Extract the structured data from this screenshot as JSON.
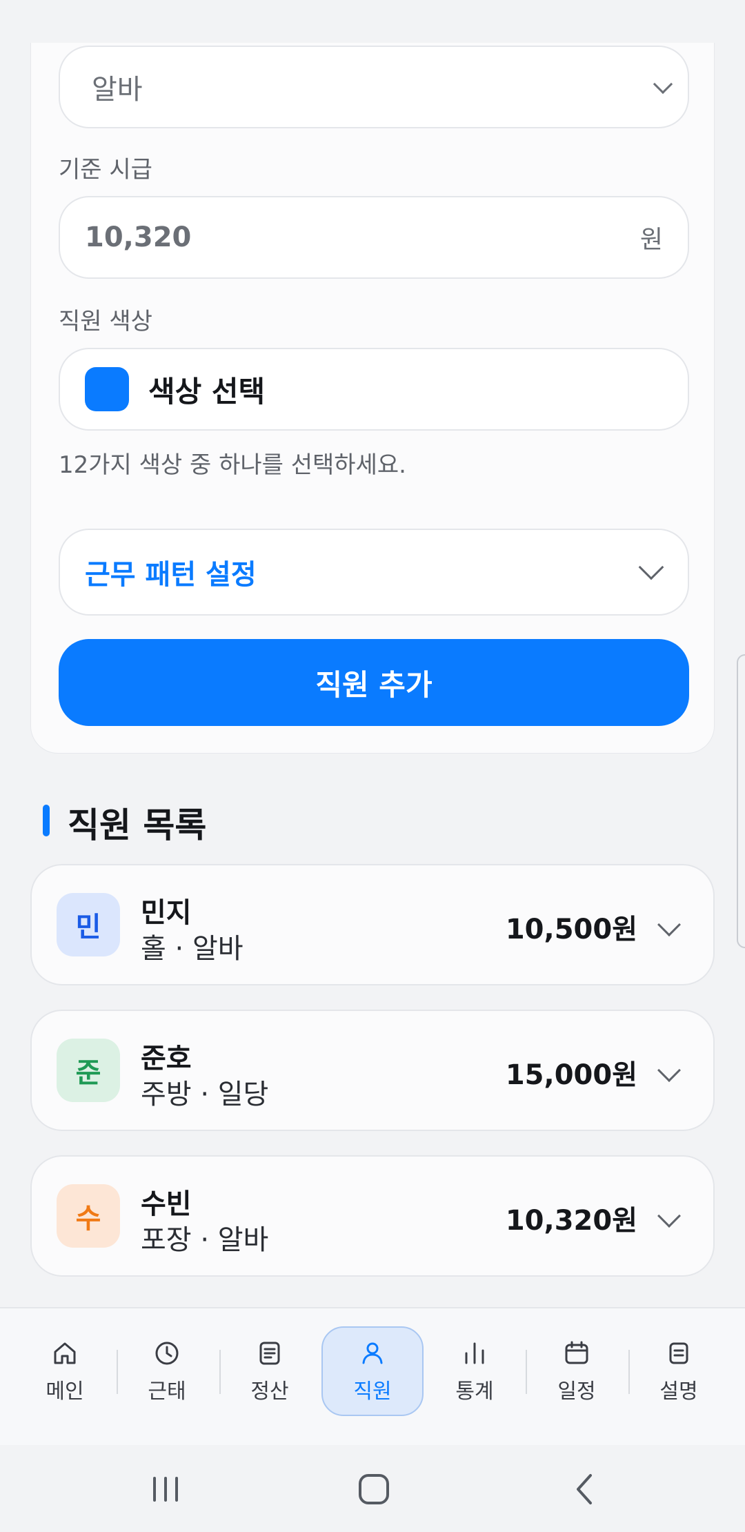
{
  "form": {
    "type_select": {
      "value": "알바"
    },
    "wage": {
      "label": "기준 시급",
      "value": "10,320",
      "unit": "원"
    },
    "color": {
      "label": "직원 색상",
      "button_label": "색상 선택",
      "hint": "12가지 색상 중 하나를 선택하세요.",
      "selected_color": "#0a7bff"
    },
    "pattern": {
      "label": "근무 패턴 설정"
    },
    "add_button_label": "직원 추가"
  },
  "employee_list": {
    "title": "직원 목록",
    "items": [
      {
        "initial": "민",
        "name": "민지",
        "meta": "홀 · 알바",
        "wage": "10,500원",
        "avatar_bg": "#dbe6fd",
        "avatar_fg": "#1a5be6"
      },
      {
        "initial": "준",
        "name": "준호",
        "meta": "주방 · 일당",
        "wage": "15,000원",
        "avatar_bg": "#dcf1e4",
        "avatar_fg": "#1f9a55"
      },
      {
        "initial": "수",
        "name": "수빈",
        "meta": "포장 · 알바",
        "wage": "10,320원",
        "avatar_bg": "#fde6d6",
        "avatar_fg": "#f07a16"
      }
    ]
  },
  "bottom_nav": {
    "items": [
      {
        "label": "메인",
        "icon": "home-icon"
      },
      {
        "label": "근태",
        "icon": "clock-icon"
      },
      {
        "label": "정산",
        "icon": "document-icon"
      },
      {
        "label": "직원",
        "icon": "person-icon",
        "active": true
      },
      {
        "label": "통계",
        "icon": "bar-chart-icon"
      },
      {
        "label": "일정",
        "icon": "calendar-icon"
      },
      {
        "label": "설명",
        "icon": "note-icon"
      }
    ]
  },
  "colors": {
    "accent": "#0a7bff",
    "background": "#f2f3f5"
  }
}
